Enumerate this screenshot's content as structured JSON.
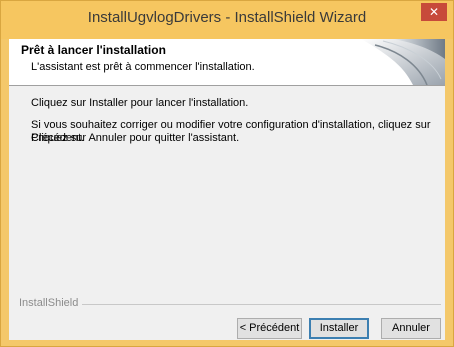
{
  "window": {
    "title": "InstallUgvlogDrivers - InstallShield Wizard",
    "close_glyph": "✕"
  },
  "header": {
    "title": "Prêt à lancer l'installation",
    "subtitle": "L'assistant est prêt à commencer l'installation."
  },
  "body": {
    "line1": "Cliquez sur Installer pour lancer l'installation.",
    "line2": "Si vous souhaitez corriger ou modifier votre configuration d'installation, cliquez sur Précédent.",
    "line3": "Cliquez sur Annuler pour quitter l'assistant."
  },
  "footer": {
    "brand": "InstallShield"
  },
  "buttons": {
    "back": "< Précédent",
    "install": "Installer",
    "cancel": "Annuler"
  },
  "colors": {
    "titlebar": "#f6c660",
    "close": "#c74a3a",
    "dialog_bg": "#f0f0f0",
    "default_button_border": "#3c7fb1"
  }
}
